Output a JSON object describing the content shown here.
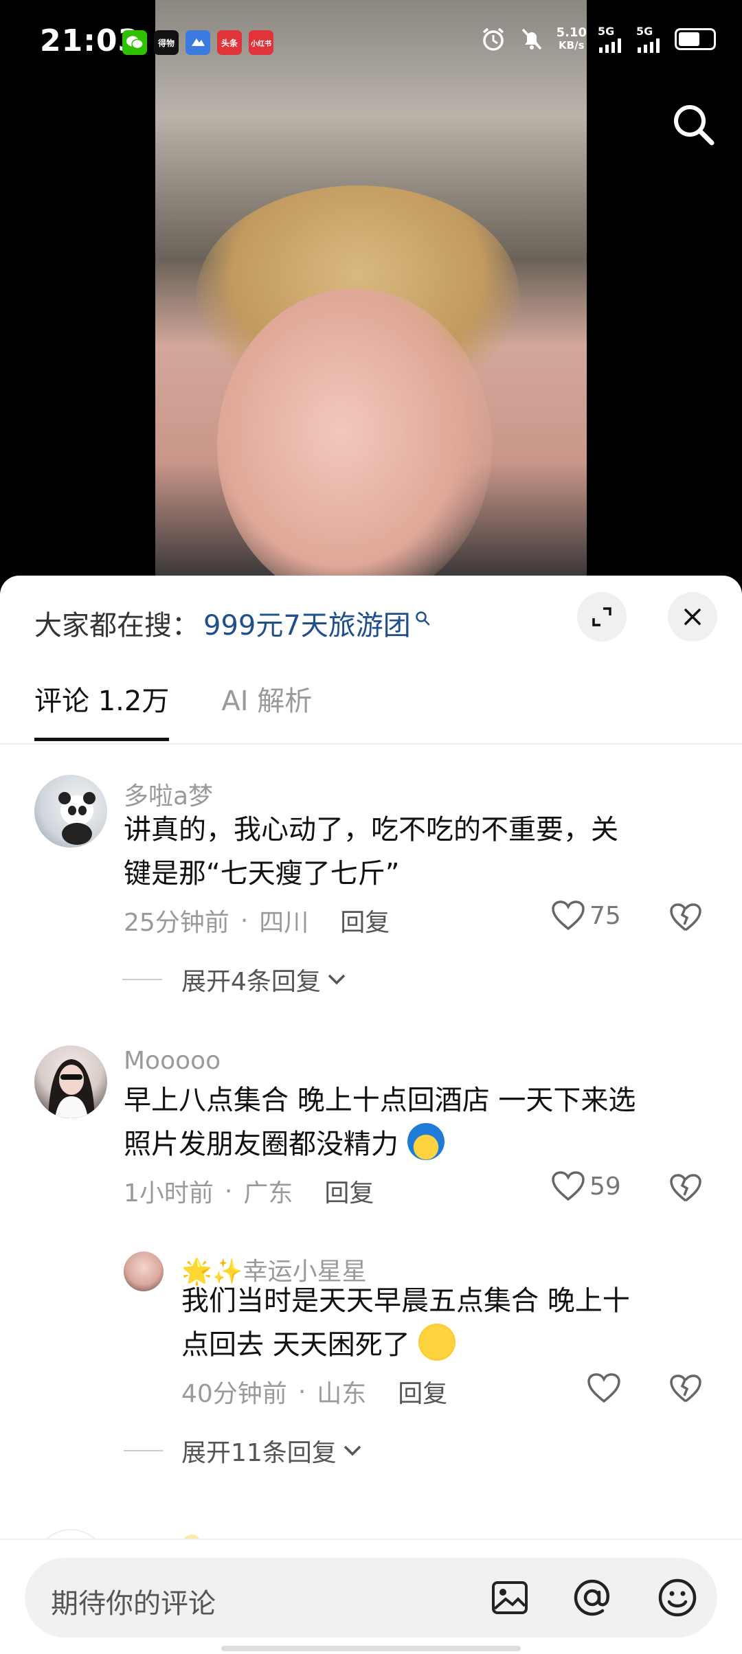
{
  "status_bar": {
    "time": "21:03",
    "notif_icons": [
      {
        "name": "wechat-icon",
        "label": "",
        "color": "#2dc100"
      },
      {
        "name": "dewu-icon",
        "label": "得物",
        "color": "#111111"
      },
      {
        "name": "map-icon",
        "label": "",
        "color": "#3b7be0"
      },
      {
        "name": "toutiao-icon",
        "label": "头条",
        "color": "#e0333a"
      },
      {
        "name": "xiaohongshu-icon",
        "label": "小红书",
        "color": "#e0333a"
      }
    ],
    "net_speed": "5.10",
    "net_unit": "KB/s",
    "sim1": "5G",
    "sim2": "5G"
  },
  "search_suggestion": {
    "prefix": "大家都在搜：",
    "keyword": "999元7天旅游团"
  },
  "tabs": [
    {
      "label": "评论 1.2万",
      "active": true
    },
    {
      "label": "AI 解析",
      "active": false
    }
  ],
  "comments": [
    {
      "username": "多啦a梦",
      "text_line1": "讲真的，我心动了，吃不吃的不重要，关",
      "text_line2": "键是那“七天瘦了七斤”",
      "time": "25分钟前",
      "location": "四川",
      "reply_label": "回复",
      "likes": "75",
      "expand_label": "展开4条回复"
    },
    {
      "username": "Mooooo",
      "text_line1": "早上八点集合 晚上十点回酒店 一天下来选",
      "text_line2": "照片发朋友圈都没精力",
      "time": "1小时前",
      "location": "广东",
      "reply_label": "回复",
      "likes": "59"
    }
  ],
  "sub_reply": {
    "username": "🌟✨幸运小星星",
    "text_line1": "我们当时是天天早晨五点集合  晚上十",
    "text_line2": "点回去  天天困死了",
    "time": "40分钟前",
    "location": "山东",
    "reply_label": "回复",
    "expand_label": "展开11条回复"
  },
  "input": {
    "placeholder": "期待你的评论"
  },
  "colors": {
    "keyword": "#1f4f8c",
    "text": "#111111",
    "muted": "#9a9a9a"
  }
}
